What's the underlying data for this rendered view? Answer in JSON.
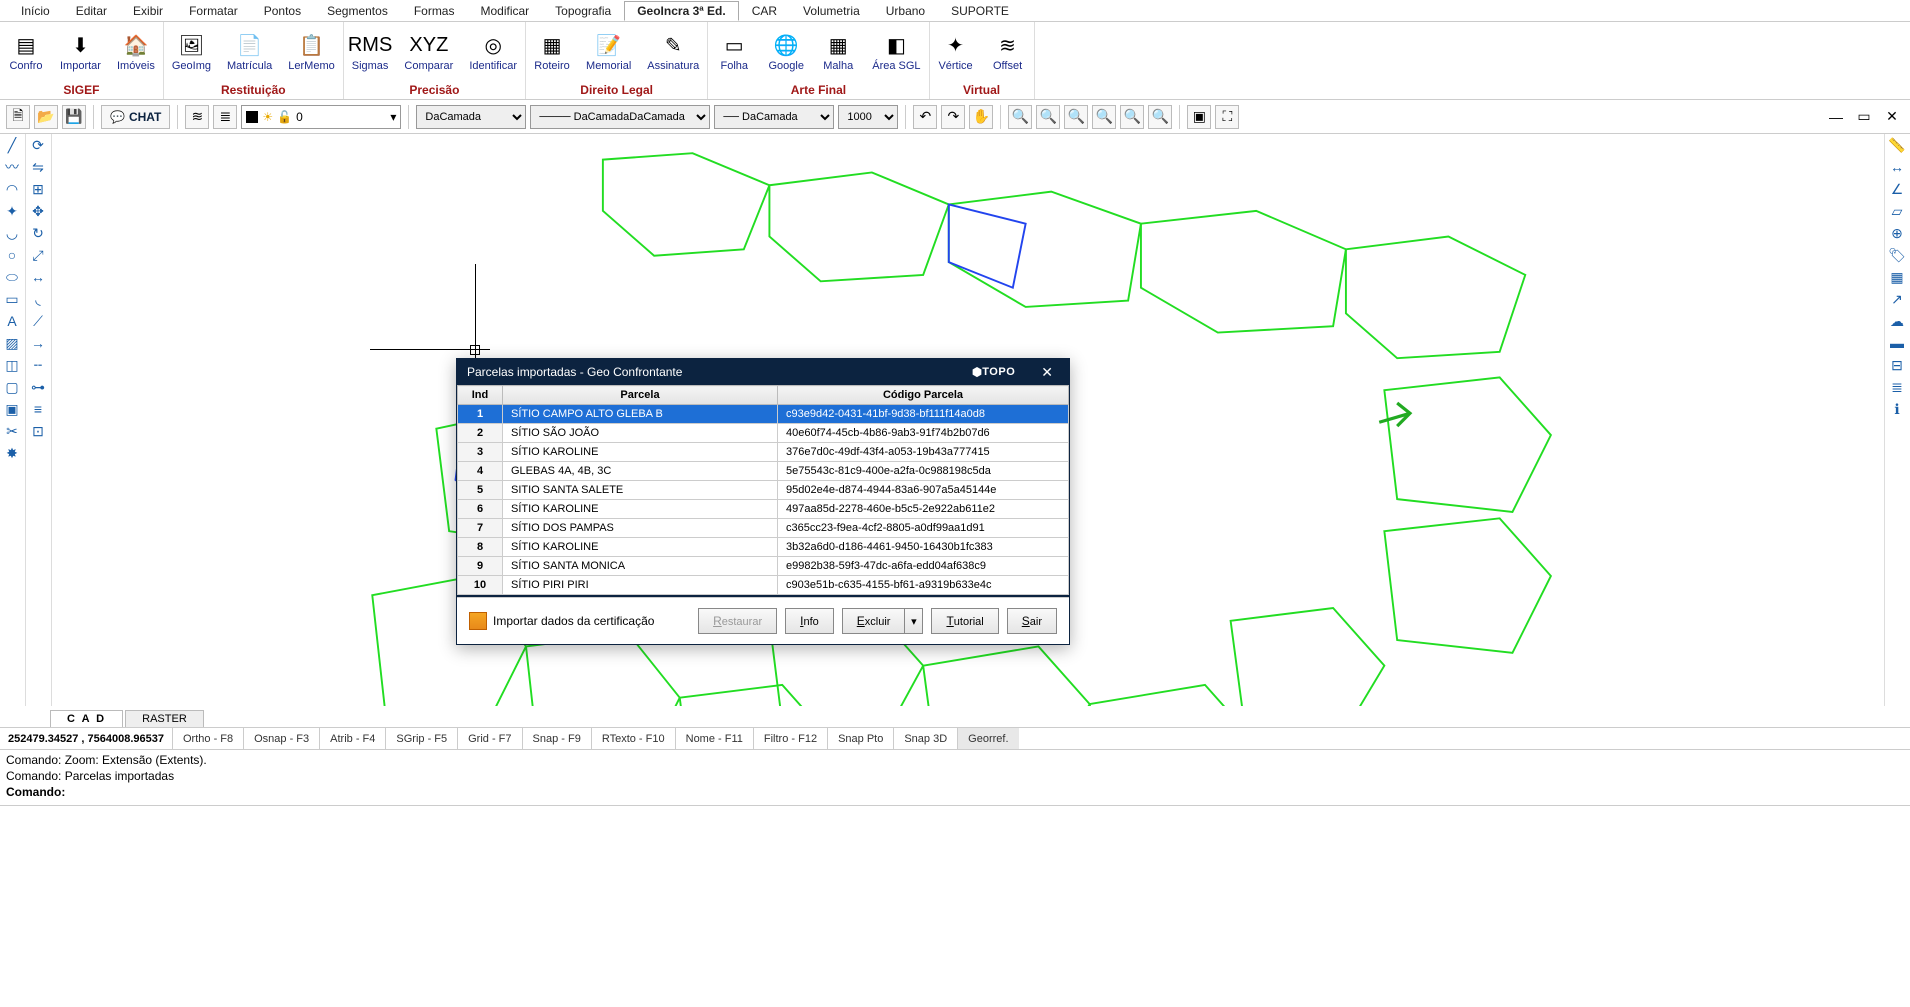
{
  "menu": {
    "tabs": [
      "Início",
      "Editar",
      "Exibir",
      "Formatar",
      "Pontos",
      "Segmentos",
      "Formas",
      "Modificar",
      "Topografia",
      "GeoIncra 3ª Ed.",
      "CAR",
      "Volumetria",
      "Urbano",
      "SUPORTE"
    ],
    "activeIndex": 9
  },
  "ribbon": {
    "groups": [
      {
        "label": "SIGEF",
        "buttons": [
          {
            "n": "Confro",
            "i": "▤"
          },
          {
            "n": "Importar",
            "i": "⬇"
          },
          {
            "n": "Imóveis",
            "i": "🏠"
          }
        ]
      },
      {
        "label": "Restituição",
        "buttons": [
          {
            "n": "GeoImg",
            "i": "🖼"
          },
          {
            "n": "Matrícula",
            "i": "📄"
          },
          {
            "n": "LerMemo",
            "i": "📋"
          }
        ]
      },
      {
        "label": "Precisão",
        "buttons": [
          {
            "n": "Sigmas",
            "i": "RMS"
          },
          {
            "n": "Comparar",
            "i": "XYZ"
          },
          {
            "n": "Identificar",
            "i": "◎"
          }
        ]
      },
      {
        "label": "Direito Legal",
        "buttons": [
          {
            "n": "Roteiro",
            "i": "▦"
          },
          {
            "n": "Memorial",
            "i": "📝"
          },
          {
            "n": "Assinatura",
            "i": "✎"
          }
        ]
      },
      {
        "label": "Arte Final",
        "buttons": [
          {
            "n": "Folha",
            "i": "▭"
          },
          {
            "n": "Google",
            "i": "🌐"
          },
          {
            "n": "Malha",
            "i": "▦"
          },
          {
            "n": "Área SGL",
            "i": "◧"
          }
        ]
      },
      {
        "label": "Virtual",
        "buttons": [
          {
            "n": "Vértice",
            "i": "✦"
          },
          {
            "n": "Offset",
            "i": "≋"
          }
        ]
      }
    ]
  },
  "toolbar": {
    "chat": "CHAT",
    "layer_name": "0",
    "linetype1": "DaCamada",
    "linetype2": "DaCamada",
    "linetype3": "DaCamada",
    "scale": "1000"
  },
  "dialog": {
    "title": "Parcelas importadas - Geo Confrontante",
    "brand": "TOPO",
    "headers": {
      "ind": "Ind",
      "parcela": "Parcela",
      "codigo": "Código Parcela"
    },
    "rows": [
      {
        "ind": "1",
        "parcela": "SÍTIO CAMPO ALTO  GLEBA B",
        "codigo": "c93e9d42-0431-41bf-9d38-bf111f14a0d8"
      },
      {
        "ind": "2",
        "parcela": "SÍTIO SÃO JOÃO",
        "codigo": "40e60f74-45cb-4b86-9ab3-91f74b2b07d6"
      },
      {
        "ind": "3",
        "parcela": "SÍTIO KAROLINE",
        "codigo": "376e7d0c-49df-43f4-a053-19b43a777415"
      },
      {
        "ind": "4",
        "parcela": "GLEBAS 4A, 4B, 3C",
        "codigo": "5e75543c-81c9-400e-a2fa-0c988198c5da"
      },
      {
        "ind": "5",
        "parcela": "SITIO SANTA SALETE",
        "codigo": "95d02e4e-d874-4944-83a6-907a5a45144e"
      },
      {
        "ind": "6",
        "parcela": "SÍTIO KAROLINE",
        "codigo": "497aa85d-2278-460e-b5c5-2e922ab611e2"
      },
      {
        "ind": "7",
        "parcela": "SÍTIO DOS PAMPAS",
        "codigo": "c365cc23-f9ea-4cf2-8805-a0df99aa1d91"
      },
      {
        "ind": "8",
        "parcela": "SÍTIO KAROLINE",
        "codigo": "3b32a6d0-d186-4461-9450-16430b1fc383"
      },
      {
        "ind": "9",
        "parcela": "SÍTIO SANTA MONICA",
        "codigo": "e9982b38-59f3-47dc-a6fa-edd04af638c9"
      },
      {
        "ind": "10",
        "parcela": "SÍTIO PIRI PIRI",
        "codigo": "c903e51b-c635-4155-bf61-a9319b633e4c"
      }
    ],
    "selected": 0,
    "import_label": "Importar dados da certificação",
    "btn_restaurar": "Restaurar",
    "btn_info": "Info",
    "btn_excluir": "Excluir",
    "btn_tutorial": "Tutorial",
    "btn_sair": "Sair"
  },
  "view_tabs": {
    "cad": "C A D",
    "raster": "RASTER"
  },
  "status": {
    "coords": "252479.34527 , 7564008.96537",
    "buttons": [
      "Ortho - F8",
      "Osnap - F3",
      "Atrib - F4",
      "SGrip - F5",
      "Grid - F7",
      "Snap - F9",
      "RTexto - F10",
      "Nome - F11",
      "Filtro - F12",
      "Snap Pto",
      "Snap 3D",
      "Georref."
    ],
    "activeIndex": 11
  },
  "cmd": {
    "line1": "Comando: Zoom: Extensão (Extents).",
    "line2": "Comando: Parcelas importadas",
    "prompt": "Comando:"
  }
}
